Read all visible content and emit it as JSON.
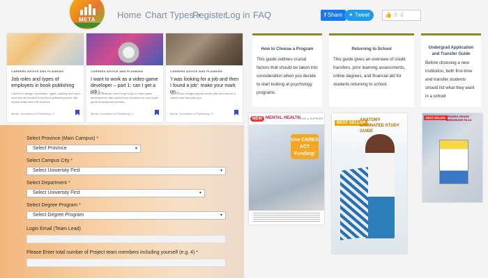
{
  "nav": {
    "logo_text": "META",
    "links": [
      "Home",
      "Chart Types",
      "Register",
      "Log in",
      "FAQ"
    ],
    "share_label": "Share",
    "tweet_label": "Tweet",
    "dropdown_icon": "caret-down-icon"
  },
  "cards": [
    {
      "category": "CAREERS ADVICE AND PLANNING",
      "title": "Job roles and types of employers in book publishing",
      "desc": "Careers in design, production, rights, publicity and much more are all involved in the book publishing world. We explain what each role involves...",
      "meta": "Media, Journalism & Publishing • 3"
    },
    {
      "category": "CAREERS ADVICE AND PLANNING",
      "title": "I want to work as a video game developer – part 1: can I get a job i...",
      "desc": "Find out what you need to get a job in video game development, with advice from recruiters on how to get game development studios...",
      "meta": "Media, Journalism & Publishing • 3"
    },
    {
      "category": "CAREERS ADVICE AND PLANNING",
      "title": "'I was looking for a job and then I found a job': make your mark on...",
      "desc": "Take a look at eight popular music jobs and choose a career path that suits you.",
      "meta": "Media, Journalism & Publishing • 3"
    }
  ],
  "guides": [
    {
      "title": "How to Choose a Program",
      "text": "This guide outlines crucial factors that should be taken into consideration when you decide to start looking at psychology programs."
    },
    {
      "title": "Returning to School",
      "text": "This guide gives an overview of credit transfers, prior learning assessments, online degrees, and financial aid for students returning to school."
    },
    {
      "title": "Undergrad Application and Transfer Guide",
      "text": "Before choosing a new institution, both first-time and transfer students should list what they want in a school"
    }
  ],
  "form": {
    "province_label": "Select Province (Main Campus)",
    "province_value": "Select Province",
    "city_label": "Select Campus City",
    "city_value": "Select University First",
    "department_label": "Select Department",
    "department_value": "Select University First",
    "degree_label": "Select Degree Program",
    "degree_value": "Select Degree Program",
    "email_label": "Login Email (Team Lead)",
    "members_label": "Please Enter total number of Project team members including yourself (e.g. 4)",
    "required_mark": "*"
  },
  "products": [
    {
      "badge": "NEW",
      "title": "MENTAL HEALTH",
      "subtitle": "SIGNS & SUPPORT",
      "sticker": "Use CARES ACT Funding!"
    },
    {
      "badge": "BEST SELLER",
      "title": "ANATOMY LAMINATED STUDY GUIDE"
    },
    {
      "badge": "BEST SELLER",
      "title": "SPANISH GRADE MEMORIZER PACK"
    }
  ],
  "colors": {
    "nav_text": "#7b8fa3",
    "facebook": "#1877f2",
    "twitter": "#1d9bf0",
    "guide_accent": "#8a8a1f",
    "required": "#d0021b"
  }
}
